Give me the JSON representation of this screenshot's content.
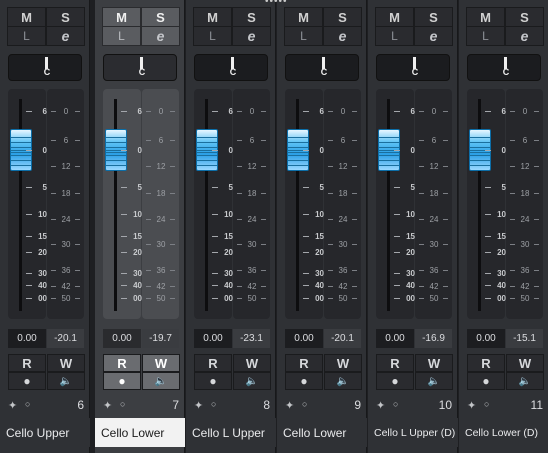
{
  "mixer": {
    "colors": {
      "accent": "#2a9fe6",
      "selected_name_bg": "#f2f2f2"
    },
    "channels": [
      {
        "name": "Cello Upper",
        "number": "6",
        "volume": "0.00",
        "peak": "-20.1",
        "mute": "M",
        "solo": "S",
        "listen": "L",
        "edit": "e",
        "pan": "C",
        "read": "R",
        "write": "W",
        "read_icon": "record-dot",
        "write_icon": "speaker",
        "selected": false
      },
      {
        "name": "Cello Lower",
        "number": "7",
        "volume": "0.00",
        "peak": "-19.7",
        "mute": "M",
        "solo": "S",
        "listen": "L",
        "edit": "e",
        "pan": "C",
        "read": "R",
        "write": "W",
        "read_icon": "record-dot",
        "write_icon": "speaker",
        "selected": true
      },
      {
        "name": "Cello L Upper",
        "number": "8",
        "volume": "0.00",
        "peak": "-23.1",
        "mute": "M",
        "solo": "S",
        "listen": "L",
        "edit": "e",
        "pan": "C",
        "read": "R",
        "write": "W",
        "read_icon": "record-dot",
        "write_icon": "speaker",
        "selected": false
      },
      {
        "name": "Cello Lower",
        "number": "9",
        "volume": "0.00",
        "peak": "-20.1",
        "mute": "M",
        "solo": "S",
        "listen": "L",
        "edit": "e",
        "pan": "C",
        "read": "R",
        "write": "W",
        "read_icon": "record-dot",
        "write_icon": "speaker",
        "selected": false
      },
      {
        "name": "Cello L Upper (D)",
        "number": "10",
        "volume": "0.00",
        "peak": "-16.9",
        "mute": "M",
        "solo": "S",
        "listen": "L",
        "edit": "e",
        "pan": "C",
        "read": "R",
        "write": "W",
        "read_icon": "record-dot",
        "write_icon": "speaker",
        "selected": false
      },
      {
        "name": "Cello Lower (D)",
        "number": "11",
        "volume": "0.00",
        "peak": "-15.1",
        "mute": "M",
        "solo": "S",
        "listen": "L",
        "edit": "e",
        "pan": "C",
        "read": "R",
        "write": "W",
        "read_icon": "record-dot",
        "write_icon": "speaker",
        "selected": false
      }
    ],
    "fader_scale": [
      "6",
      "0",
      "5",
      "10",
      "15",
      "20",
      "30",
      "40",
      "00"
    ],
    "meter_scale": [
      "0",
      "6",
      "12",
      "18",
      "24",
      "30",
      "36",
      "42",
      "50"
    ]
  }
}
